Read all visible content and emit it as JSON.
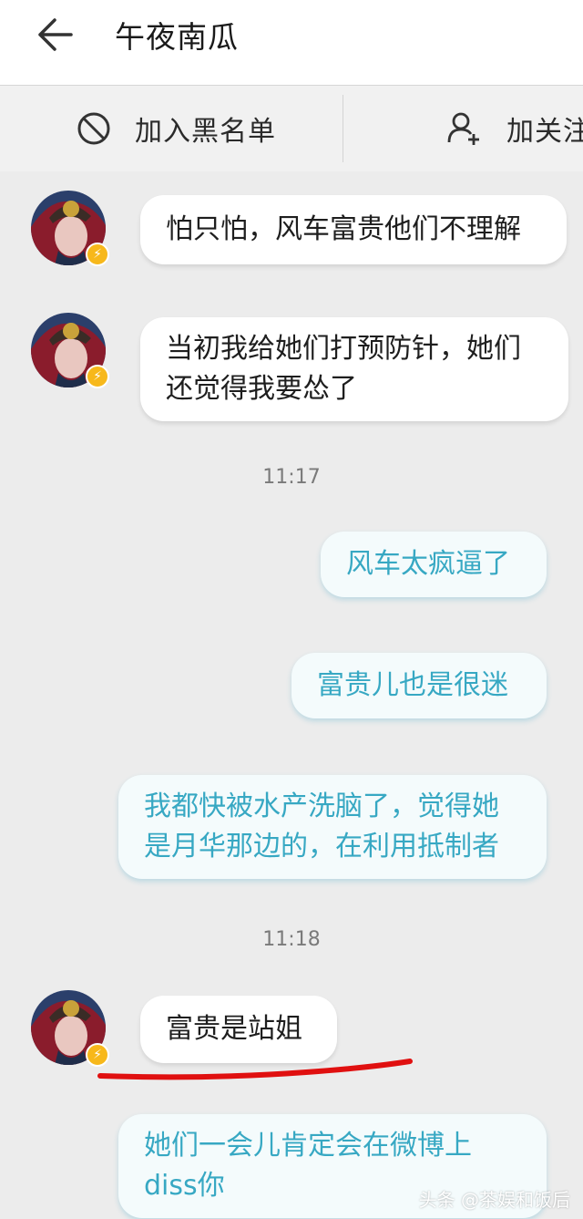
{
  "header": {
    "title": "午夜南瓜"
  },
  "actions": {
    "block_label": "加入黑名单",
    "follow_label": "加关注"
  },
  "messages": [
    {
      "side": "in",
      "text": "怕只怕，风车富贵他们不理解"
    },
    {
      "side": "in",
      "text": "当初我给她们打预防针，她们\n还觉得我要怂了"
    },
    {
      "time": "11:17"
    },
    {
      "side": "out",
      "text": "风车太疯逼了"
    },
    {
      "side": "out",
      "text": "富贵儿也是很迷"
    },
    {
      "side": "out",
      "text": "我都快被水产洗脑了，觉得她\n是月华那边的，在利用抵制者"
    },
    {
      "time": "11:18"
    },
    {
      "side": "in",
      "text": "富贵是站姐"
    },
    {
      "side": "out",
      "text": "她们一会儿肯定会在微博上\ndiss你"
    }
  ],
  "watermark": "头条 @茶娱和饭后",
  "colors": {
    "outgoing_text": "#37a8c3",
    "badge": "#f7b81b",
    "annotation": "#e01010"
  }
}
